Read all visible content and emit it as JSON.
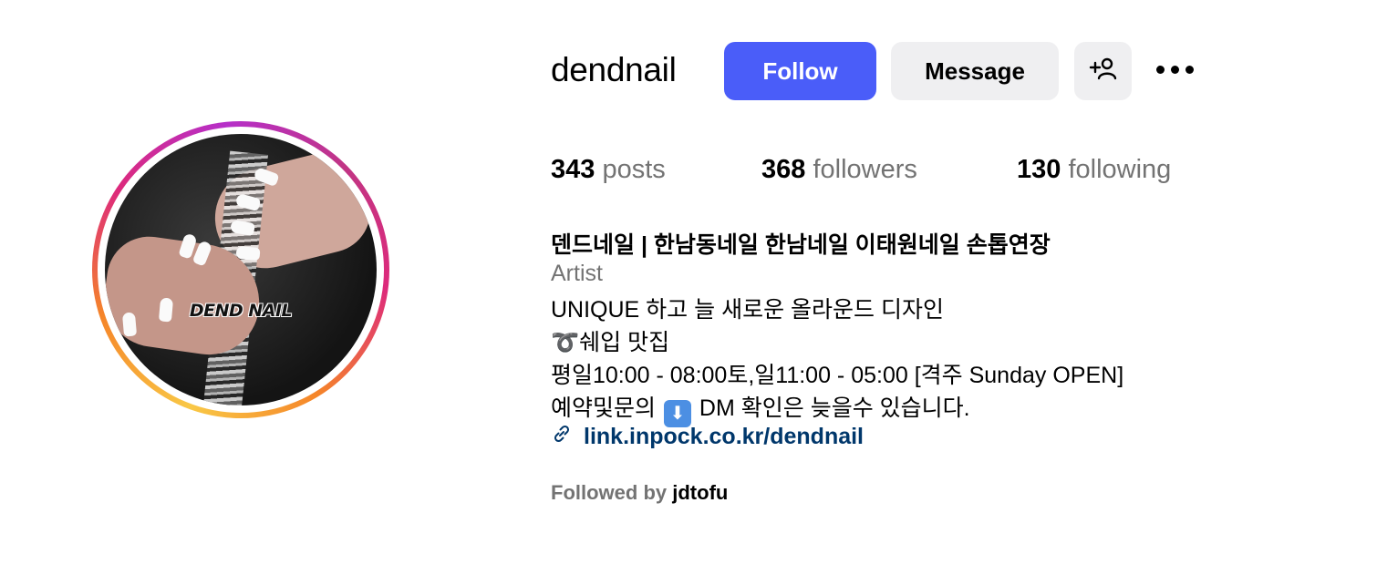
{
  "profile": {
    "username": "dendnail",
    "avatar_text": "DEND NAIL"
  },
  "actions": {
    "follow_label": "Follow",
    "message_label": "Message",
    "add_user_icon": "add-user-icon",
    "more_icon": "more-options-icon"
  },
  "stats": {
    "posts_count": "343",
    "posts_label": "posts",
    "followers_count": "368",
    "followers_label": "followers",
    "following_count": "130",
    "following_label": "following"
  },
  "bio": {
    "name": "덴드네일 | 한남동네일 한남네일 이태원네일 손톱연장",
    "category": "Artist",
    "line1": "UNIQUE 하고 늘 새로운 올라운드 디자인",
    "line2": "➰쉐입 맛집",
    "line3": "평일10:00 - 08:00토,일11:00 - 05:00 [격주 Sunday OPEN]",
    "line4_before": "예약및문의",
    "line4_after": "DM 확인은 늦을수 있습니다.",
    "link": "link.inpock.co.kr/dendnail"
  },
  "followed_by": {
    "prefix": "Followed by",
    "user": "jdtofu"
  },
  "colors": {
    "follow_button": "#4a5df9",
    "secondary_button": "#efeff1",
    "link": "#00376b",
    "muted_text": "#737373"
  }
}
